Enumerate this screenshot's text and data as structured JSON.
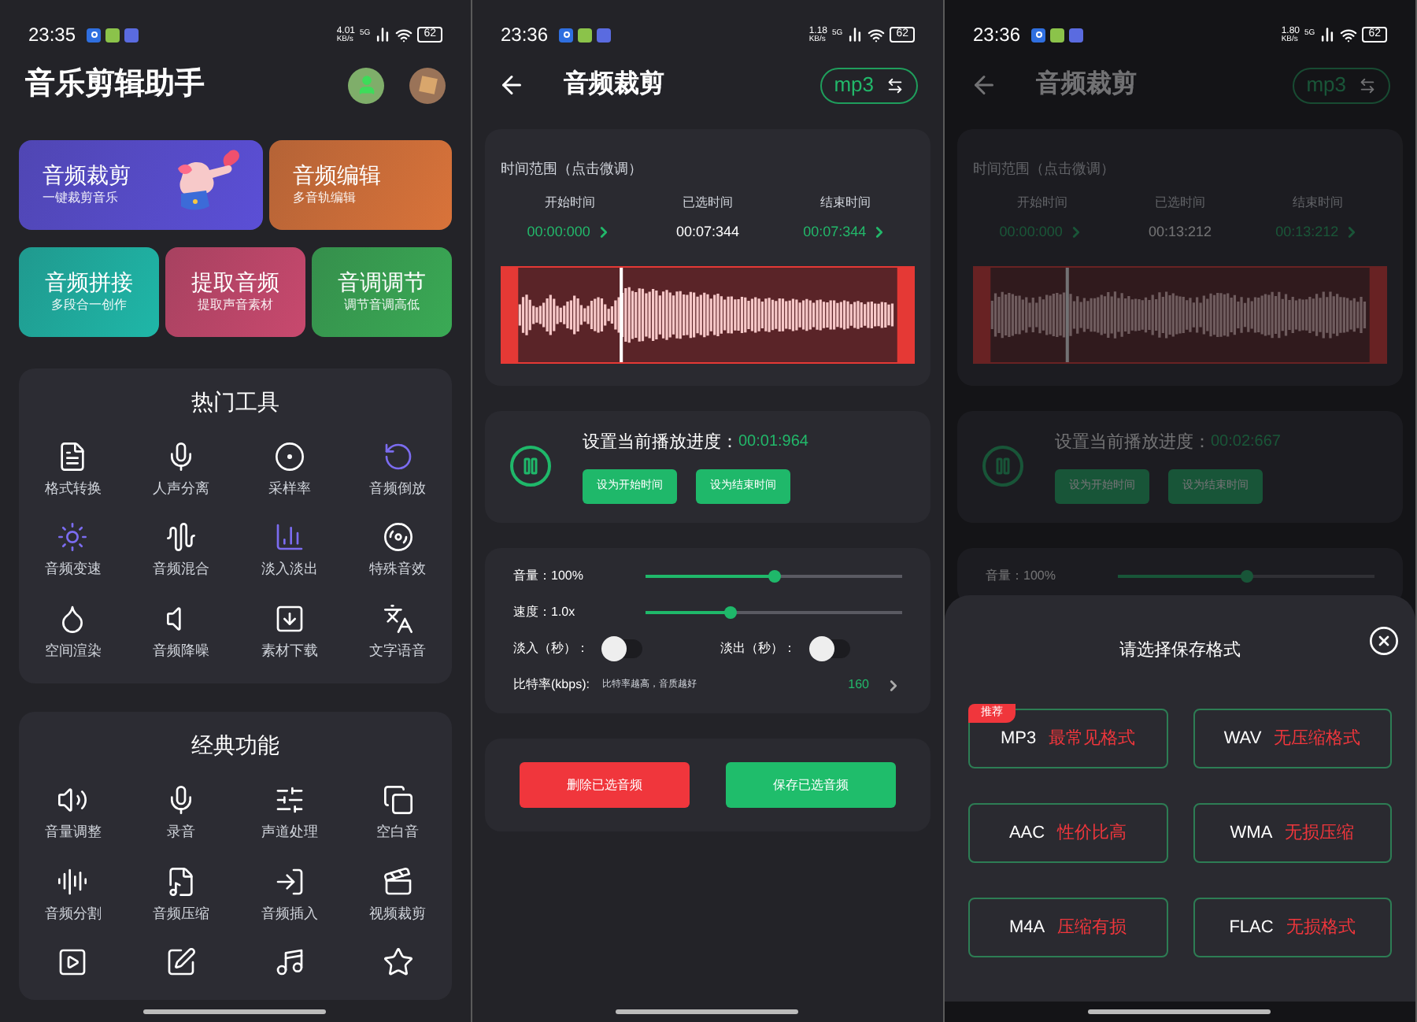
{
  "screens": [
    {
      "kind": "home",
      "status": {
        "time": "23:35",
        "speed": "4.01",
        "speed_unit": "KB/s",
        "network": "5G",
        "battery": "62"
      },
      "title": "音乐剪辑助手",
      "hero_rows": [
        [
          {
            "title": "音频裁剪",
            "subtitle": "一键裁剪音乐",
            "color": "#5b4fd6",
            "kind": "illustrated"
          },
          {
            "title": "音频编辑",
            "subtitle": "多音轨编辑",
            "color": "#d9733a",
            "kind": "plain"
          }
        ],
        [
          {
            "title": "音频拼接",
            "subtitle": "多段合一创作",
            "color": "#1fb7a8",
            "kind": "plain"
          },
          {
            "title": "提取音频",
            "subtitle": "提取声音素材",
            "color": "#c8496e",
            "kind": "plain"
          },
          {
            "title": "音调调节",
            "subtitle": "调节音调高低",
            "color": "#3aaa55",
            "kind": "plain"
          }
        ]
      ],
      "sections": [
        {
          "title": "热门工具",
          "tools": [
            {
              "kind": "labeled",
              "label": "格式转换"
            },
            {
              "kind": "labeled",
              "label": "人声分离"
            },
            {
              "kind": "labeled",
              "label": "采样率"
            },
            {
              "kind": "labeled",
              "label": "音频倒放"
            },
            {
              "kind": "labeled",
              "label": "音频变速"
            },
            {
              "kind": "labeled",
              "label": "音频混合"
            },
            {
              "kind": "labeled",
              "label": "淡入淡出"
            },
            {
              "kind": "labeled",
              "label": "特殊音效"
            },
            {
              "kind": "labeled",
              "label": "空间渲染"
            },
            {
              "kind": "labeled",
              "label": "音频降噪"
            },
            {
              "kind": "labeled",
              "label": "素材下载"
            },
            {
              "kind": "labeled",
              "label": "文字语音"
            }
          ]
        },
        {
          "title": "经典功能",
          "tools": [
            {
              "kind": "labeled",
              "label": "音量调整"
            },
            {
              "kind": "labeled",
              "label": "录音"
            },
            {
              "kind": "labeled",
              "label": "声道处理"
            },
            {
              "kind": "labeled",
              "label": "空白音"
            },
            {
              "kind": "labeled",
              "label": "音频分割"
            },
            {
              "kind": "labeled",
              "label": "音频压缩"
            },
            {
              "kind": "labeled",
              "label": "音频插入"
            },
            {
              "kind": "labeled",
              "label": "视频裁剪"
            },
            {
              "kind": "icon_only"
            },
            {
              "kind": "icon_only"
            },
            {
              "kind": "icon_only"
            },
            {
              "kind": "icon_only"
            }
          ]
        }
      ]
    },
    {
      "kind": "editor",
      "dimmed": false,
      "status": {
        "time": "23:36",
        "speed": "1.18",
        "speed_unit": "KB/s",
        "network": "5G",
        "battery": "62"
      },
      "title": "音频裁剪",
      "format": "mp3",
      "range": {
        "heading": "时间范围（点击微调）",
        "columns": [
          {
            "label": "开始时间",
            "value": "00:00:000",
            "kind": "adjustable"
          },
          {
            "label": "已选时间",
            "value": "00:07:344",
            "kind": "plain"
          },
          {
            "label": "结束时间",
            "value": "00:07:344",
            "kind": "adjustable"
          }
        ]
      },
      "waveform": {
        "level": 0.27,
        "kind": "varied"
      },
      "progress": {
        "label": "设置当前播放进度：",
        "value": "00:01:964",
        "buttons": [
          "设为开始时间",
          "设为结束时间"
        ]
      },
      "sliders": [
        {
          "label": "音量：100%",
          "level": 0.5
        },
        {
          "label": "速度：1.0x",
          "level": 0.33
        }
      ],
      "toggles": [
        {
          "label": "淡入（秒）：",
          "on": false
        },
        {
          "label": "淡出（秒）：",
          "on": false
        }
      ],
      "bitrate": {
        "label": "比特率(kbps):",
        "hint": "比特率越高，音质越好",
        "value": "160"
      },
      "actions": [
        {
          "label": "删除已选音频",
          "kind": "danger"
        },
        {
          "label": "保存已选音频",
          "kind": "primary"
        }
      ]
    },
    {
      "kind": "editor",
      "dimmed": true,
      "status": {
        "time": "23:36",
        "speed": "1.80",
        "speed_unit": "KB/s",
        "network": "5G",
        "battery": "62"
      },
      "title": "音频裁剪",
      "format": "mp3",
      "range": {
        "heading": "时间范围（点击微调）",
        "columns": [
          {
            "label": "开始时间",
            "value": "00:00:000",
            "kind": "adjustable"
          },
          {
            "label": "已选时间",
            "value": "00:13:212",
            "kind": "plain"
          },
          {
            "label": "结束时间",
            "value": "00:13:212",
            "kind": "adjustable"
          }
        ]
      },
      "waveform": {
        "level": 0.2,
        "kind": "steady"
      },
      "progress": {
        "label": "设置当前播放进度：",
        "value": "00:02:667",
        "buttons": [
          "设为开始时间",
          "设为结束时间"
        ]
      },
      "sliders": [
        {
          "label": "音量：100%",
          "level": 0.5
        }
      ],
      "sheet": {
        "title": "请选择保存格式",
        "options": [
          {
            "format": "MP3",
            "note": "最常见格式",
            "badge": "推荐"
          },
          {
            "format": "WAV",
            "note": "无压缩格式"
          },
          {
            "format": "AAC",
            "note": "性价比高"
          },
          {
            "format": "WMA",
            "note": "无损压缩"
          },
          {
            "format": "M4A",
            "note": "压缩有损"
          },
          {
            "format": "FLAC",
            "note": "无损格式"
          }
        ]
      }
    }
  ]
}
